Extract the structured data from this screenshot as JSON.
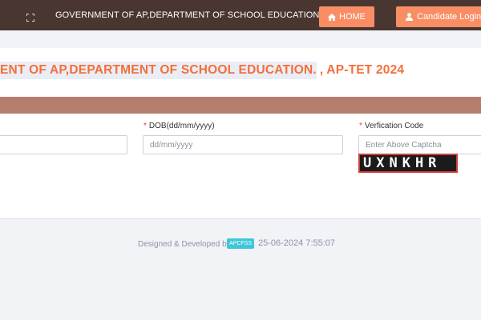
{
  "header": {
    "expand_icon": "expand-fullscreen-icon",
    "title": "GOVERNMENT OF AP,DEPARTMENT OF SCHOOL EDUCATION.",
    "home_label": "HOME",
    "login_label": "Candidate Login"
  },
  "main": {
    "heading_highlighted": "ENT OF AP,DEPARTMENT OF SCHOOL EDUCATION.",
    "heading_rest": ", AP-TET 2024",
    "fields": {
      "dob_label": "DOB(dd/mm/yyyy)",
      "dob_placeholder": "dd/mm/yyyy",
      "captcha_label": "Verfication Code",
      "captcha_placeholder": "Enter Above Captcha",
      "captcha_text": "UXNKHR",
      "required_mark": "*"
    }
  },
  "footer": {
    "designed_by": "Designed & Developed by",
    "badge": "APCFSS",
    "timestamp": "25-06-2024 7:55:07"
  },
  "colors": {
    "topbar": "#4a3630",
    "button": "#f98e65",
    "heading": "#f56e38",
    "band": "#b57d6e",
    "badge": "#3fc6d8"
  }
}
